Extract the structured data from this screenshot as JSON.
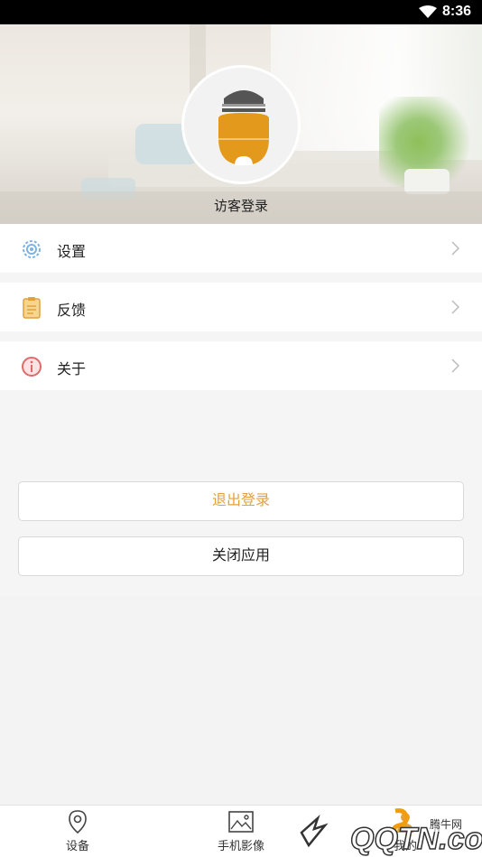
{
  "status_bar": {
    "time": "8:36"
  },
  "profile": {
    "username": "访客登录"
  },
  "menu": [
    {
      "label": "设置",
      "icon": "settings-icon"
    },
    {
      "label": "反馈",
      "icon": "feedback-icon"
    },
    {
      "label": "关于",
      "icon": "about-icon"
    }
  ],
  "actions": {
    "logout_label": "退出登录",
    "close_app_label": "关闭应用"
  },
  "tabbar": {
    "tabs": [
      {
        "label": "设备",
        "icon": "location-pin-icon"
      },
      {
        "label": "手机影像",
        "icon": "image-icon"
      },
      {
        "label": "我的",
        "icon": "person-icon"
      }
    ]
  },
  "watermark": {
    "text": "腾牛网",
    "domain": "QQTN.com"
  },
  "colors": {
    "accent": "#e2a23a",
    "avatar_body": "#e39a1c"
  }
}
